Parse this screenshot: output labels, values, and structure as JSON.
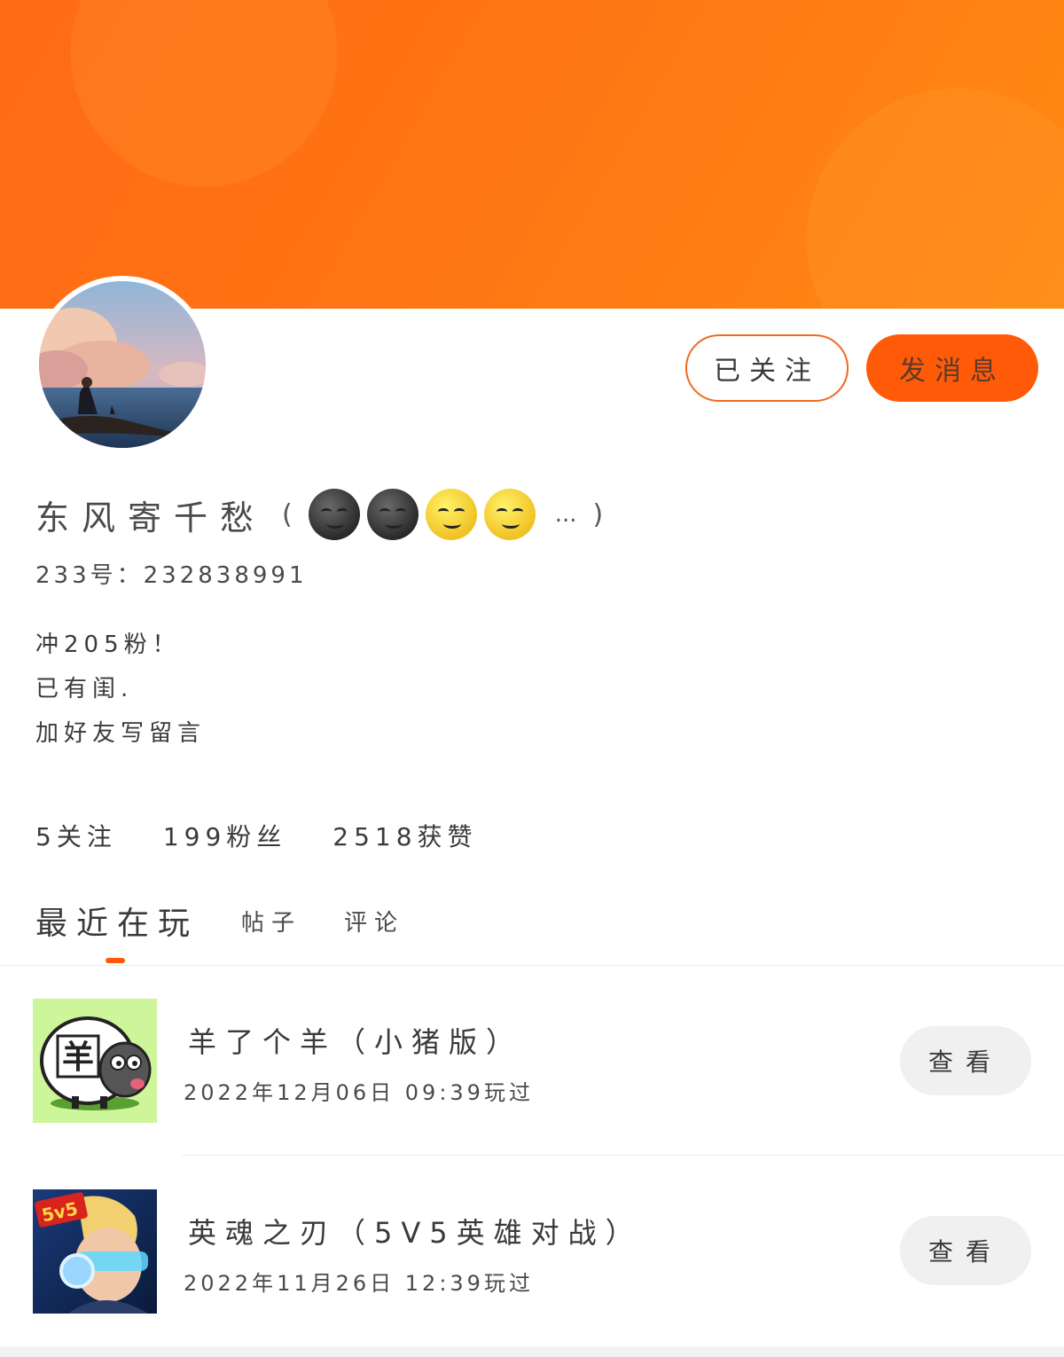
{
  "profile": {
    "name": "东风寄千愁",
    "name_paren_open": "(",
    "name_paren_close": ")",
    "name_ellipsis": "...",
    "emoji_icons": [
      "new-moon-face-icon",
      "new-moon-face-icon",
      "full-moon-face-icon",
      "full-moon-face-icon"
    ],
    "uid_line": "233号：232838991",
    "bio": [
      "冲205粉！",
      "已有闺.",
      "加好友写留言"
    ]
  },
  "actions": {
    "follow_label": "已关注",
    "message_label": "发消息"
  },
  "stats": {
    "following": "5关注",
    "followers": "199粉丝",
    "likes": "2518获赞"
  },
  "tabs": {
    "recent": "最近在玩",
    "posts": "帖子",
    "comments": "评论"
  },
  "games": [
    {
      "title": "羊了个羊（小猪版）",
      "time": "2022年12月06日 09:39玩过",
      "view_label": "查看",
      "icon": "sheep-game-icon"
    },
    {
      "title": "英魂之刃（5V5英雄对战）",
      "time": "2022年11月26日 12:39玩过",
      "view_label": "查看",
      "icon": "hero-game-icon"
    }
  ],
  "colors": {
    "accent": "#ff5a08",
    "banner": "#ff7614",
    "follow_border": "#f06a1d"
  }
}
